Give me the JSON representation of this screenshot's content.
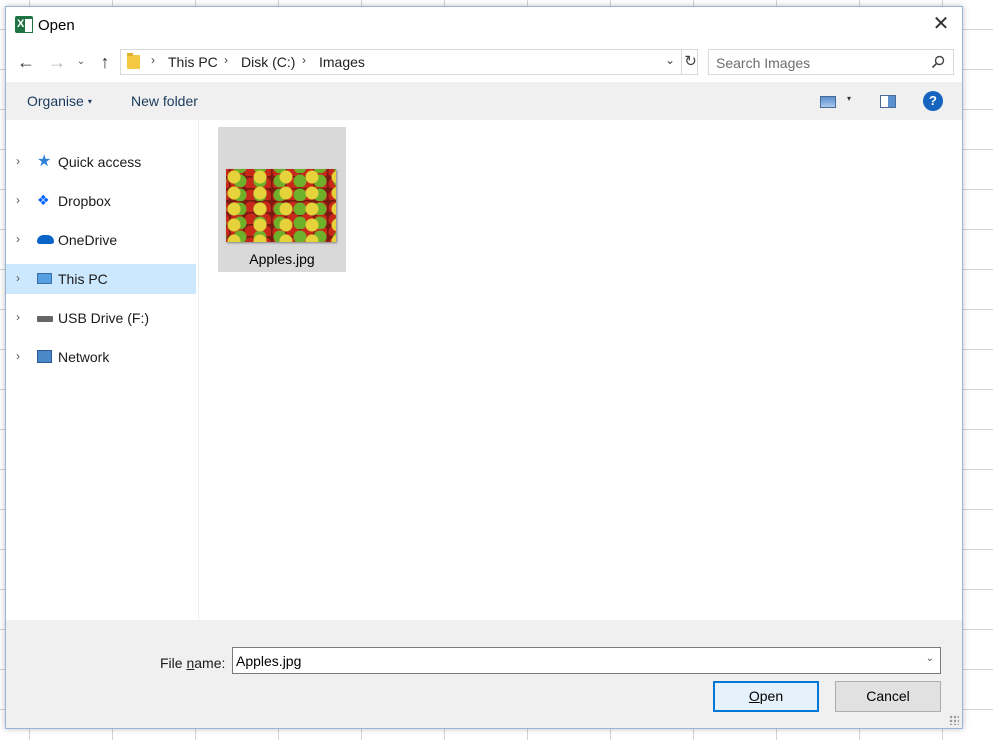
{
  "window": {
    "title": "Open",
    "close_label": "✕"
  },
  "nav": {
    "back": "←",
    "forward": "→",
    "recent": "⌄",
    "up": "↑"
  },
  "address": {
    "crumbs": [
      "This PC",
      "Disk (C:)",
      "Images"
    ],
    "separator": "›",
    "dropdown": "⌄",
    "refresh": "↻"
  },
  "search": {
    "placeholder": "Search Images"
  },
  "toolbar": {
    "organise_label": "Organise",
    "organise_caret": "▾",
    "new_folder_label": "New folder",
    "view_caret": "▾",
    "help_label": "?"
  },
  "sidebar": {
    "items": [
      {
        "label": "Quick access",
        "icon": "star-icon"
      },
      {
        "label": "Dropbox",
        "icon": "dropbox-icon"
      },
      {
        "label": "OneDrive",
        "icon": "onedrive-cloud-icon"
      },
      {
        "label": "This PC",
        "icon": "computer-icon",
        "selected": true
      },
      {
        "label": "USB Drive (F:)",
        "icon": "usb-drive-icon"
      },
      {
        "label": "Network",
        "icon": "network-icon"
      }
    ],
    "chevron": "›"
  },
  "files": [
    {
      "name": "Apples.jpg",
      "selected": true
    }
  ],
  "footer": {
    "file_name_label_pre": "File ",
    "file_name_label_mnemonic": "n",
    "file_name_label_post": "ame:",
    "file_name_value": "Apples.jpg",
    "dropdown": "⌄",
    "open_mnemonic": "O",
    "open_rest": "pen",
    "cancel_label": "Cancel"
  },
  "colors": {
    "accent": "#0078d7",
    "selection": "#cce8ff",
    "panel": "#f0f0f0",
    "excel_green": "#1f7244"
  }
}
